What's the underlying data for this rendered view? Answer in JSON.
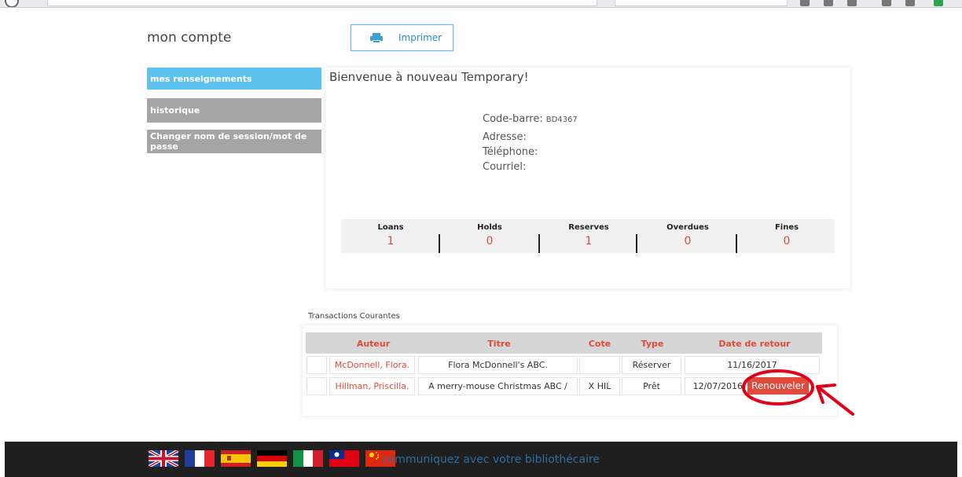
{
  "page": {
    "title": "mon compte",
    "print_label": "Imprimer",
    "welcome": "Bienvenue à nouveau Temporary!"
  },
  "sidebar": {
    "items": [
      {
        "label": "mes renseignements",
        "active": true
      },
      {
        "label": "historique",
        "active": false
      },
      {
        "label": "Changer nom de session/mot de passe",
        "active": false
      }
    ]
  },
  "info": {
    "barcode_label": "Code-barre:",
    "barcode_value": "BD4367",
    "address_label": "Adresse:",
    "phone_label": "Téléphone:",
    "email_label": "Courriel:"
  },
  "stats": [
    {
      "label": "Loans",
      "value": "1"
    },
    {
      "label": "Holds",
      "value": "0"
    },
    {
      "label": "Reserves",
      "value": "1"
    },
    {
      "label": "Overdues",
      "value": "0"
    },
    {
      "label": "Fines",
      "value": "0"
    }
  ],
  "transactions": {
    "title": "Transactions Courantes",
    "headers": {
      "author": "Auteur",
      "title": "Titre",
      "cote": "Cote",
      "type": "Type",
      "due": "Date de retour"
    },
    "rows": [
      {
        "author": "McDonnell, Flora.",
        "title": "Flora McDonnell's ABC.",
        "cote": "",
        "type": "Réserver",
        "due": "11/16/2017"
      },
      {
        "author": "Hillman, Priscilla.",
        "title": "A merry-mouse Christmas ABC /",
        "cote": "X HIL",
        "type": "Prêt",
        "due": "12/07/2016"
      }
    ],
    "renew_label": "Renouveler"
  },
  "footer": {
    "link": "communiquez avec votre bibliothécaire",
    "flags": [
      "uk-flag-icon",
      "france-flag-icon",
      "spain-flag-icon",
      "germany-flag-icon",
      "italy-flag-icon",
      "taiwan-flag-icon",
      "china-flag-icon"
    ]
  },
  "colors": {
    "accent": "#5ec2ef",
    "red": "#e14a3a",
    "sidebar_gray": "#a5a5a5",
    "footer": "#1f1f1f",
    "link": "#2e6f9e"
  }
}
